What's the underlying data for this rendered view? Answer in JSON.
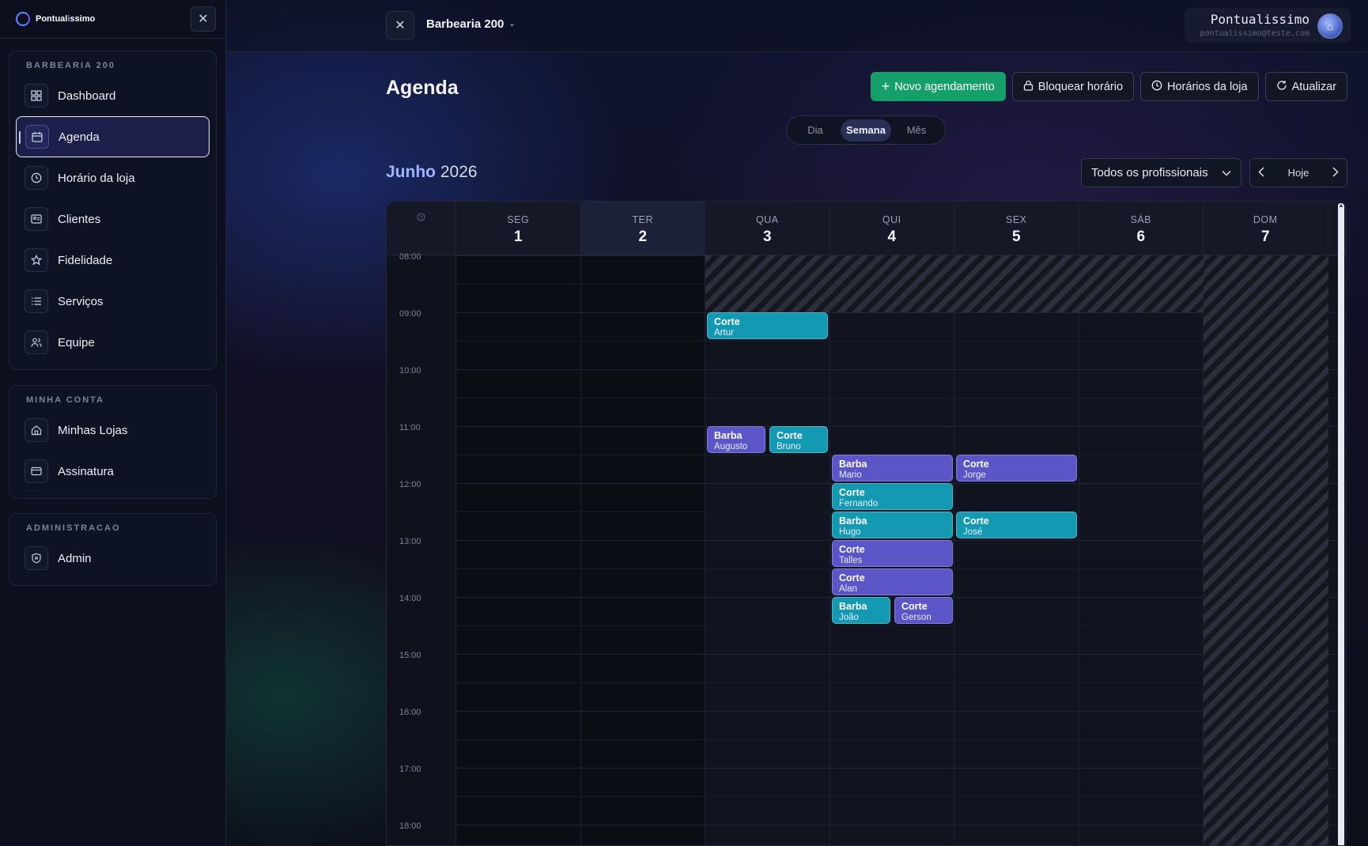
{
  "brand": {
    "prefix": "Pontual",
    "highlight": "i",
    "suffix": "ssimo"
  },
  "sidebar": {
    "groups": [
      {
        "title": "BARBEARIA 200",
        "items": [
          {
            "label": "Dashboard",
            "icon": "grid-icon"
          },
          {
            "label": "Agenda",
            "icon": "calendar-icon",
            "active": true
          },
          {
            "label": "Horário da loja",
            "icon": "clock-icon"
          },
          {
            "label": "Clientes",
            "icon": "contacts-icon"
          },
          {
            "label": "Fidelidade",
            "icon": "star-icon"
          },
          {
            "label": "Serviços",
            "icon": "list-icon"
          },
          {
            "label": "Equipe",
            "icon": "users-icon"
          }
        ]
      },
      {
        "title": "MINHA CONTA",
        "items": [
          {
            "label": "Minhas Lojas",
            "icon": "home-icon"
          },
          {
            "label": "Assinatura",
            "icon": "card-icon"
          }
        ]
      },
      {
        "title": "ADMINISTRACAO",
        "items": [
          {
            "label": "Admin",
            "icon": "shield-icon"
          }
        ]
      }
    ]
  },
  "topbar": {
    "store": "Barbearia 200",
    "user_name": "Pontualissimo",
    "user_email": "pontualissimo@teste.com"
  },
  "page": {
    "title": "Agenda",
    "actions": [
      "Novo agendamento",
      "Bloquear horário",
      "Horários da loja",
      "Atualizar"
    ],
    "views": [
      "Dia",
      "Semana",
      "Mês"
    ],
    "active_view": "Semana",
    "month": "Junho",
    "year": "2026",
    "professional_filter": "Todos os profissionais",
    "today_label": "Hoje"
  },
  "calendar": {
    "days": [
      {
        "name": "SEG",
        "num": "1"
      },
      {
        "name": "TER",
        "num": "2"
      },
      {
        "name": "QUA",
        "num": "3"
      },
      {
        "name": "QUI",
        "num": "4"
      },
      {
        "name": "SEX",
        "num": "5"
      },
      {
        "name": "SÁB",
        "num": "6"
      },
      {
        "name": "DOM",
        "num": "7"
      }
    ],
    "hours": [
      "08:00",
      "09:00",
      "10:00",
      "11:00",
      "12:00",
      "13:00",
      "14:00",
      "15:00",
      "16:00",
      "17:00",
      "18:00"
    ],
    "appointments": [
      {
        "service": "Corte",
        "client": "Artur"
      },
      {
        "service": "Barba",
        "client": "Augusto"
      },
      {
        "service": "Corte",
        "client": "Bruno"
      },
      {
        "service": "Barba",
        "client": "Mario"
      },
      {
        "service": "Corte",
        "client": "Fernando"
      },
      {
        "service": "Barba",
        "client": "Hugo"
      },
      {
        "service": "Corte",
        "client": "Talles"
      },
      {
        "service": "Corte",
        "client": "Alan"
      },
      {
        "service": "Barba",
        "client": "João"
      },
      {
        "service": "Corte",
        "client": "Gerson"
      },
      {
        "service": "Corte",
        "client": "Jorge"
      },
      {
        "service": "Corte",
        "client": "José"
      }
    ]
  },
  "colors": {
    "primary": "#15a06a",
    "teal": "#1499b3",
    "violet": "#5b55c8",
    "accent": "#9db5ff"
  }
}
